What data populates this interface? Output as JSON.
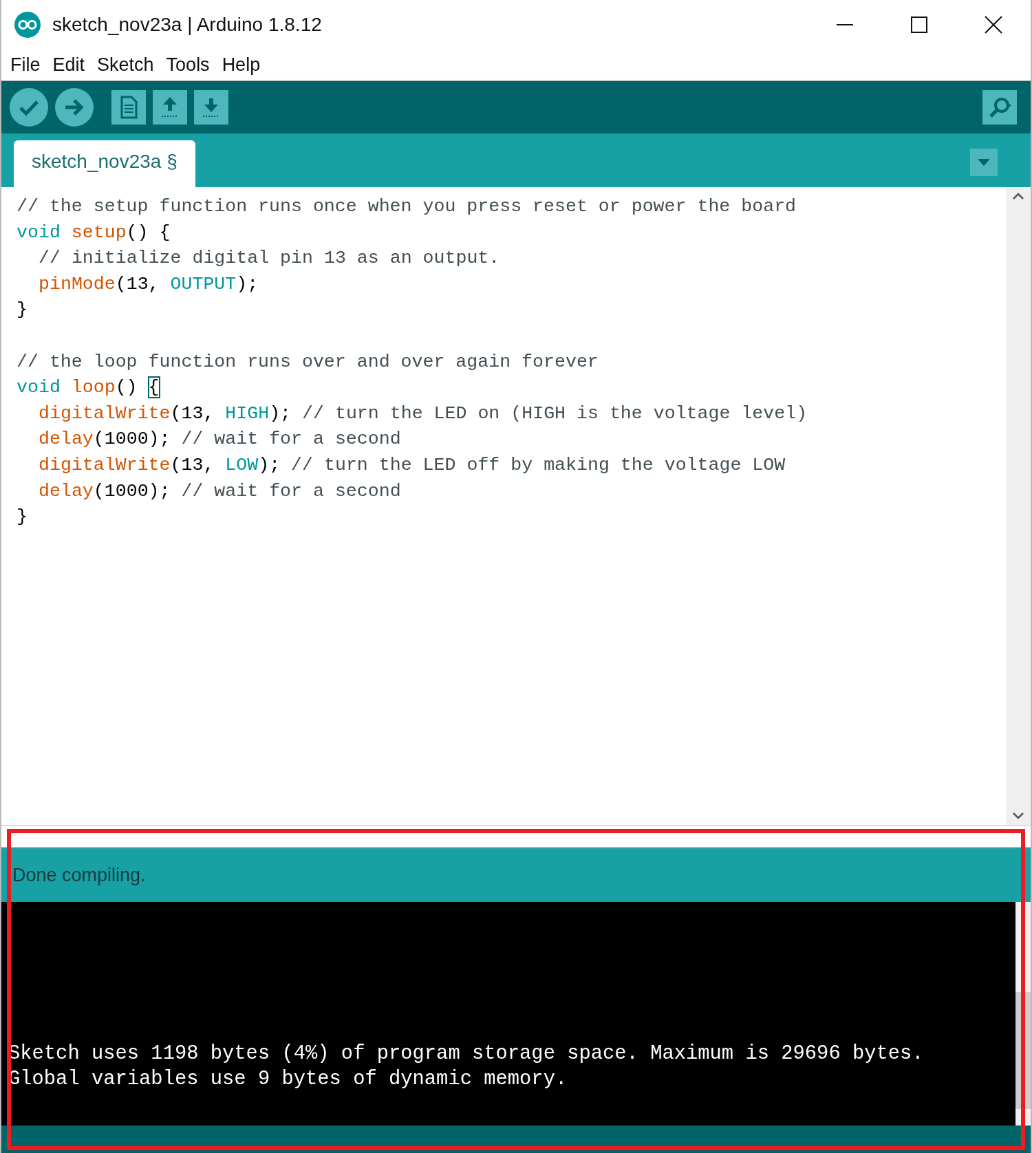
{
  "window": {
    "title": "sketch_nov23a | Arduino 1.8.12"
  },
  "menu": [
    "File",
    "Edit",
    "Sketch",
    "Tools",
    "Help"
  ],
  "tabs": [
    {
      "label": "sketch_nov23a §",
      "selected": true
    }
  ],
  "editor": {
    "lines": [
      {
        "kind": "code",
        "tokens": [
          {
            "kind": "comment",
            "text": "// the setup function runs once when you press reset or power the board"
          }
        ]
      },
      {
        "kind": "code",
        "tokens": [
          {
            "kind": "keyword",
            "text": "void"
          },
          {
            "kind": "space"
          },
          {
            "kind": "function",
            "text": "setup"
          },
          {
            "kind": "plain",
            "text": "() {"
          }
        ],
        "children": [
          {
            "kind": "code",
            "tokens": [
              {
                "kind": "comment",
                "text": "// initialize digital pin 13 as an output."
              }
            ]
          },
          {
            "kind": "code",
            "tokens": [
              {
                "kind": "function",
                "text": "pinMode"
              },
              {
                "kind": "plain",
                "text": "(13, "
              },
              {
                "kind": "constant",
                "text": "OUTPUT"
              },
              {
                "kind": "plain",
                "text": ");"
              }
            ]
          }
        ]
      },
      {
        "kind": "code",
        "tokens": [
          {
            "kind": "plain",
            "text": "}"
          }
        ]
      },
      {
        "kind": "blank"
      },
      {
        "kind": "code",
        "tokens": [
          {
            "kind": "comment",
            "text": "// the loop function runs over and over again forever"
          }
        ]
      },
      {
        "kind": "code",
        "tokens": [
          {
            "kind": "keyword",
            "text": "void"
          },
          {
            "kind": "space"
          },
          {
            "kind": "function",
            "text": "loop"
          },
          {
            "kind": "plain",
            "text": "() "
          },
          {
            "kind": "bracket",
            "text": "{"
          }
        ],
        "children": [
          {
            "kind": "code",
            "tokens": [
              {
                "kind": "function",
                "text": "digitalWrite"
              },
              {
                "kind": "plain",
                "text": "(13, "
              },
              {
                "kind": "constant",
                "text": "HIGH"
              },
              {
                "kind": "plain",
                "text": "); "
              },
              {
                "kind": "comment",
                "text": "// turn the LED on (HIGH is the voltage level)"
              }
            ]
          },
          {
            "kind": "code",
            "tokens": [
              {
                "kind": "function",
                "text": "delay"
              },
              {
                "kind": "plain",
                "text": "(1000); "
              },
              {
                "kind": "comment",
                "text": "// wait for a second"
              }
            ]
          },
          {
            "kind": "code",
            "tokens": [
              {
                "kind": "function",
                "text": "digitalWrite"
              },
              {
                "kind": "plain",
                "text": "(13, "
              },
              {
                "kind": "constant",
                "text": "LOW"
              },
              {
                "kind": "plain",
                "text": "); "
              },
              {
                "kind": "comment",
                "text": "// turn the LED off by making the voltage LOW"
              }
            ]
          },
          {
            "kind": "code",
            "tokens": [
              {
                "kind": "function",
                "text": "delay"
              },
              {
                "kind": "plain",
                "text": "(1000); "
              },
              {
                "kind": "comment",
                "text": "// wait for a second"
              }
            ]
          }
        ]
      },
      {
        "kind": "code",
        "tokens": [
          {
            "kind": "plain",
            "text": "}"
          }
        ]
      }
    ]
  },
  "status": {
    "message": "Done compiling."
  },
  "console": {
    "lines": [
      "Sketch uses 1198 bytes (4%) of program storage space. Maximum is 29696 bytes.",
      "Global variables use 9 bytes of dynamic memory."
    ]
  }
}
